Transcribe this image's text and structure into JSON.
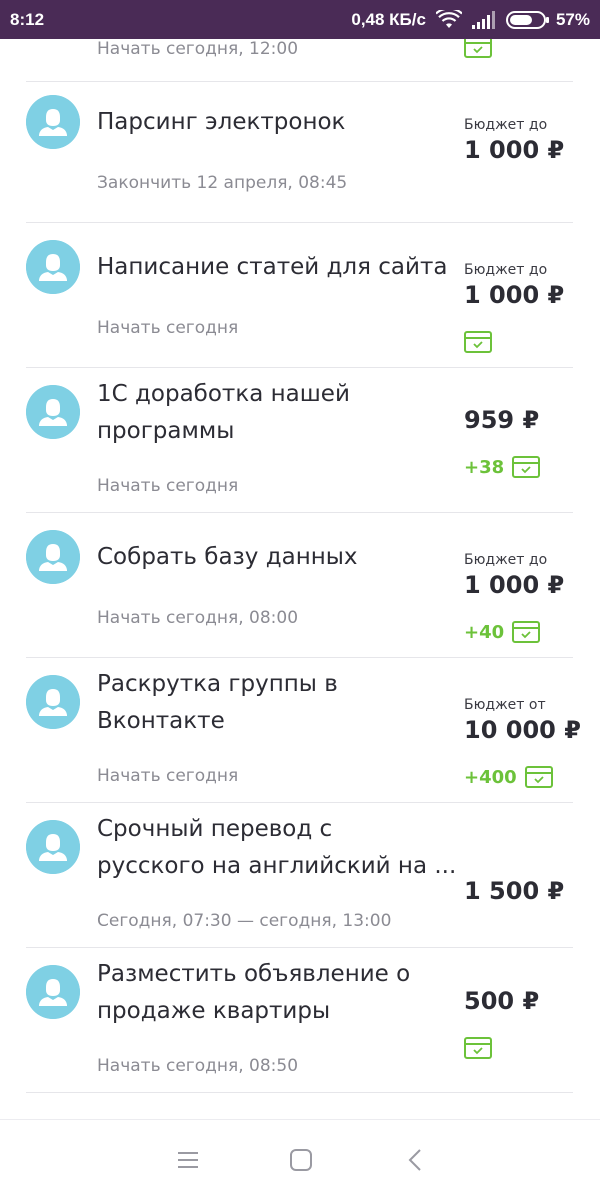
{
  "status_bar": {
    "time": "8:12",
    "speed": "0,48 КБ/с",
    "battery": "57%"
  },
  "colors": {
    "status_bg": "#4a2b56",
    "avatar": "#7fd0e4",
    "bonus_green": "#6cc23a",
    "card_icon": "#6cc23a"
  },
  "tasks": [
    {
      "title_lines": [],
      "subtitle": "Начать сегодня, 12:00",
      "budget_label": "",
      "price": "",
      "bonus": "",
      "card_icon": true
    },
    {
      "title_lines": [
        "Парсинг электронок"
      ],
      "subtitle": "Закончить 12 апреля, 08:45",
      "budget_label": "Бюджет до",
      "price": "1 000 ₽",
      "bonus": "",
      "card_icon": false
    },
    {
      "title_lines": [
        "Написание статей для сайта"
      ],
      "subtitle": "Начать сегодня",
      "budget_label": "Бюджет до",
      "price": "1 000 ₽",
      "bonus": "",
      "card_icon": true
    },
    {
      "title_lines": [
        "1С доработка нашей",
        "программы"
      ],
      "subtitle": "Начать сегодня",
      "budget_label": "",
      "price": "959 ₽",
      "bonus": "+38",
      "card_icon": true
    },
    {
      "title_lines": [
        "Собрать базу данных"
      ],
      "subtitle": "Начать сегодня, 08:00",
      "budget_label": "Бюджет до",
      "price": "1 000 ₽",
      "bonus": "+40",
      "card_icon": true
    },
    {
      "title_lines": [
        "Раскрутка группы в",
        "Вконтакте"
      ],
      "subtitle": "Начать сегодня",
      "budget_label": "Бюджет от",
      "price": "10 000 ₽",
      "bonus": "+400",
      "card_icon": true
    },
    {
      "title_lines": [
        "Срочный перевод с",
        "русского на английский на ..."
      ],
      "subtitle": "Сегодня, 07:30 — сегодня, 13:00",
      "budget_label": "",
      "price": "1 500 ₽",
      "bonus": "",
      "card_icon": false
    },
    {
      "title_lines": [
        "Разместить объявление о",
        "продаже квартиры"
      ],
      "subtitle": "Начать сегодня, 08:50",
      "budget_label": "",
      "price": "500 ₽",
      "bonus": "",
      "card_icon": true
    }
  ],
  "nav": {
    "icons": [
      "menu-icon",
      "home-square-icon",
      "back-chevron-icon"
    ]
  }
}
